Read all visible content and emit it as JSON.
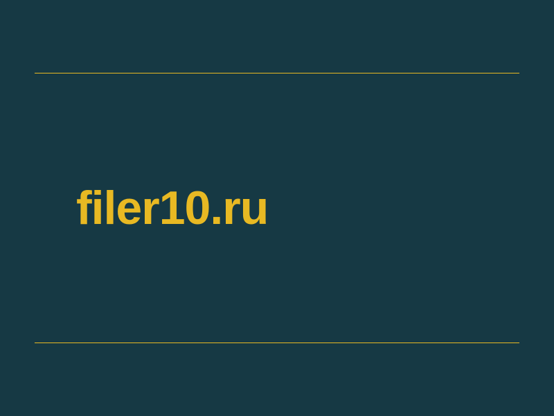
{
  "main": {
    "domain_text": "filer10.ru"
  },
  "colors": {
    "background": "#163944",
    "accent": "#e8b923"
  }
}
